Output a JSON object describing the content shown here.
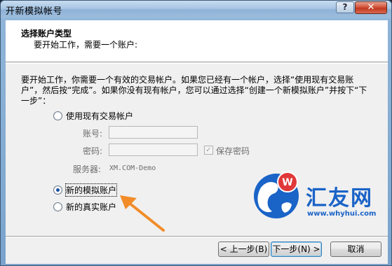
{
  "window": {
    "title": "开新模拟帐号"
  },
  "titlebar": {
    "help_label": "?",
    "close_label": "✕"
  },
  "header": {
    "title": "选择账户类型",
    "subtitle": "要开始工作，需要一个账户:"
  },
  "description": "要开始工作，你需要一个有效的交易帐户。如果您已经有一个帐户，选择“使用现有交易账户”，然后按“完成”。如果你没有现有帐户，您可以通过选择“创建一个新模拟账户”并按下“下一步”：",
  "options": {
    "existing": {
      "label": "使用现有交易帐户",
      "checked": false
    },
    "demo": {
      "label": "新的模拟账户",
      "checked": true
    },
    "real": {
      "label": "新的真实账户",
      "checked": false
    }
  },
  "existing_form": {
    "account_label": "账号:",
    "account_value": "",
    "password_label": "密码:",
    "password_value": "",
    "save_password_label": "保存密码",
    "save_password_checked": true,
    "server_label": "服务器:",
    "server_value": "XM.COM-Demo"
  },
  "buttons": {
    "back": "< 上一步(B)",
    "next": "下一步(N) >",
    "cancel": "取消"
  },
  "watermark": {
    "brand": "汇友网",
    "url": "www.whyhui.com",
    "logo_letter": "W"
  },
  "colors": {
    "accent": "#1a63c7",
    "arrow": "#f28c28",
    "logo_red": "#e0383a"
  }
}
